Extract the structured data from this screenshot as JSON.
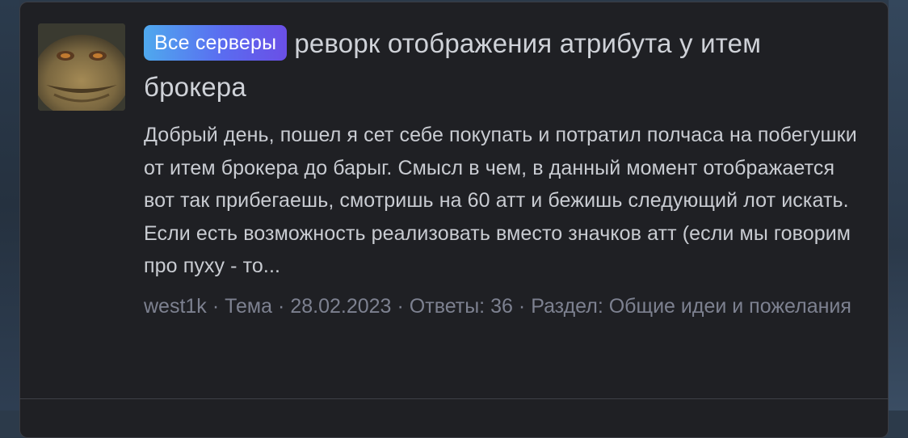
{
  "thread": {
    "badge": "Все серверы",
    "title": "реворк отображения атрибута у итем брокера",
    "snippet": "Добрый день, пошел я сет себе покупать и потратил полчаса на побегушки от итем брокера до барыг. Смысл в чем, в данный момент отображается вот так прибегаешь, смотришь на 60 атт и бежишь следующий лот искать. Если есть возможность реализовать вместо значков атт (если мы говорим про пуху - то...",
    "meta": {
      "author": "west1k",
      "type": "Тема",
      "date": "28.02.2023",
      "replies": "Ответы: 36",
      "section": "Раздел: Общие идеи и пожелания"
    }
  },
  "colors": {
    "card_bg": "#1f2024",
    "badge_gradient_start": "#4fa9ee",
    "badge_gradient_end": "#6a4fe6",
    "text": "#c9ccd2",
    "meta": "#7d8190"
  },
  "icons": {
    "avatar": "user-avatar"
  }
}
